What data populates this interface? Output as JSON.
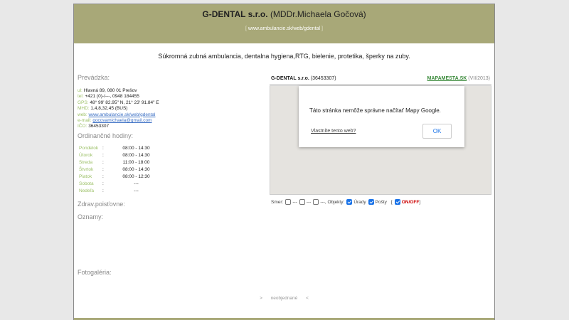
{
  "header": {
    "company": "G-DENTAL s.r.o.",
    "owner": "(MDDr.Michaela Gočová)",
    "url_open": "[",
    "url": "www.ambulancie.sk/web/gdental",
    "url_close": "]"
  },
  "subtitle": "Súkromná zubná ambulancia, dentalna hygiena,RTG, bielenie, protetika, šperky na zuby.",
  "sections": {
    "prevadzka": "Prevádzka:",
    "hours": "Ordinančné hodiny:",
    "insurance": "Zdrav.poisťovne:",
    "notices": "Oznamy:",
    "gallery": "Fotogaléria:"
  },
  "contact": {
    "address_label": "ul:",
    "address": "Hlavná 89, 080 01 Prešov",
    "tel_label": "tel:",
    "tel": "+421 (0)-/---, 0948 184455",
    "gps_label": "GPS:",
    "gps": "48° 99' 82.95\" N, 21° 23' 91.84\" E",
    "mhd_label": "MHD:",
    "mhd": "1,4,8,32,45 (BUS)",
    "web_label": "web:",
    "web": "www.ambulancie.sk/web/gdental",
    "email_label": "e-mail:",
    "email": "gocovamichaela@gmail.com",
    "ico_label": "IČO:",
    "ico": "36453307"
  },
  "hours": [
    {
      "day": "Pondelok",
      "time": "08:00 - 14:30"
    },
    {
      "day": "Útorok",
      "time": "08:00 - 14:30"
    },
    {
      "day": "Streda",
      "time": "11:00 - 18:00"
    },
    {
      "day": "Štvrtok",
      "time": "08:00 - 14:30"
    },
    {
      "day": "Piatok",
      "time": "08:00 - 12:30"
    },
    {
      "day": "Sobota",
      "time": "---"
    },
    {
      "day": "Nedeľa",
      "time": "---"
    }
  ],
  "map": {
    "name": "G-DENTAL s.r.o.",
    "ico": "(36453307)",
    "source_link": "MAPAMESTA.SK",
    "source_date": "(VII/2013)",
    "dialog_message": "Táto stránka nemôže správne načítať Mapy Google.",
    "dialog_link": "Vlastníte tento web?",
    "dialog_ok": "OK"
  },
  "filters": {
    "smer_label": "Smer:",
    "dash1": "---",
    "dash2": "---",
    "dash3": "---",
    "objekty_label": ", Objekty:",
    "urady": "Úrady",
    "posty": "Pošty",
    "bracket": "[",
    "onoff": "ON/OFF",
    "bracket_close": "]"
  },
  "pager": {
    "next": ">",
    "label": "neobjednané",
    "prev": "<"
  }
}
